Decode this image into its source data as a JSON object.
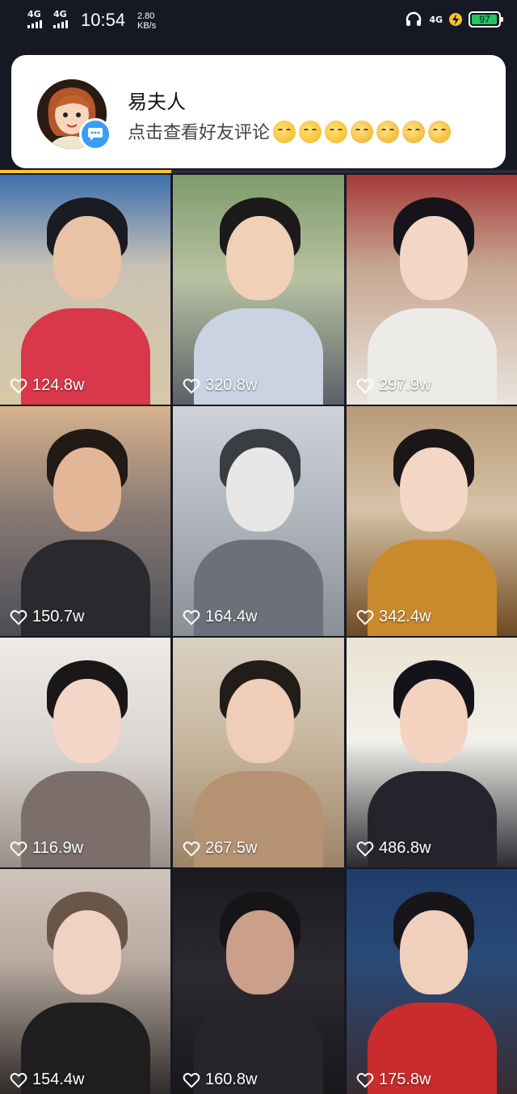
{
  "status_bar": {
    "signal1": "4G",
    "signal2": "4G",
    "time": "10:54",
    "speed_value": "2.80",
    "speed_unit": "KB/s",
    "network": "4G",
    "battery": "97",
    "battery_level": 0.97,
    "icons": [
      "headset-icon",
      "charging-bolt-icon",
      "battery-icon"
    ]
  },
  "notification": {
    "sender": "易夫人",
    "message": "点击查看好友评论",
    "icons": [
      "avatar",
      "chat-bubble-icon",
      "emoji-icon"
    ]
  },
  "colors": {
    "background": "#161823",
    "card": "#ffffff",
    "accent": "#f7c431",
    "badge": "#3b9cf6",
    "battery": "#22c55e"
  },
  "videos": [
    {
      "likes": "124.8w"
    },
    {
      "likes": "320.8w"
    },
    {
      "likes": "297.9w"
    },
    {
      "likes": "150.7w"
    },
    {
      "likes": "164.4w"
    },
    {
      "likes": "342.4w"
    },
    {
      "likes": "116.9w"
    },
    {
      "likes": "267.5w"
    },
    {
      "likes": "486.8w"
    },
    {
      "likes": "154.4w"
    },
    {
      "likes": "160.8w"
    },
    {
      "likes": "175.8w"
    }
  ]
}
